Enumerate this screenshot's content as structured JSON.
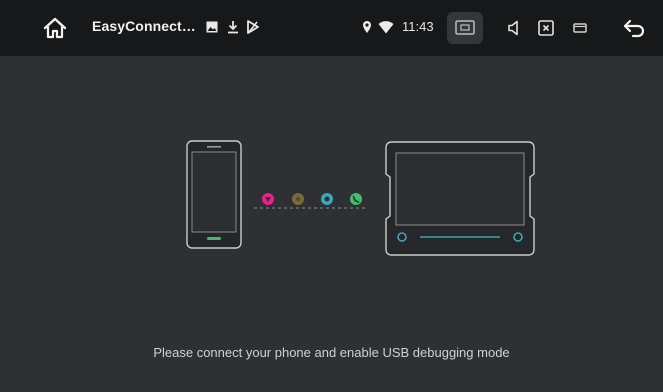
{
  "statusbar": {
    "app_title": "EasyConnect…",
    "time": "11:43",
    "icons": {
      "home": "home-icon",
      "image": "image-notification-icon",
      "download": "download-icon",
      "no_signal": "no-sim-signal-icon",
      "location": "location-icon",
      "wifi": "wifi-icon",
      "screen_cast": "screen-cast-icon",
      "volume": "volume-icon",
      "close_window": "close-window-icon",
      "window": "window-icon",
      "back": "back-icon"
    }
  },
  "illustration": {
    "dot_colors": [
      "#e8218c",
      "#7a6a3a",
      "#3aa8b8",
      "#3fbf6a"
    ],
    "accent": "#3aa8b8"
  },
  "message": "Please connect your phone and enable USB debugging mode"
}
